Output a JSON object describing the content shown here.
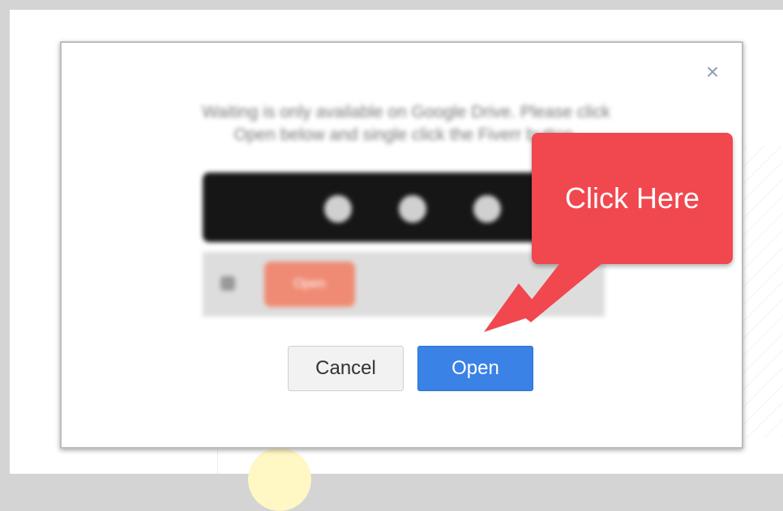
{
  "dialog": {
    "close_icon": "×",
    "blurred_message_line_1": "Waiting is only available on Google Drive. Please click",
    "blurred_message_line_2": "Open below and single click the Fiverr button.",
    "preview_open_label": "Open",
    "cancel_label": "Cancel",
    "open_label": "Open"
  },
  "callout": {
    "label": "Click Here",
    "background_color": "#f1474e"
  },
  "colors": {
    "open_button": "#3b82e6",
    "cancel_button": "#f2f2f2",
    "close_icon": "#90a0b4"
  }
}
